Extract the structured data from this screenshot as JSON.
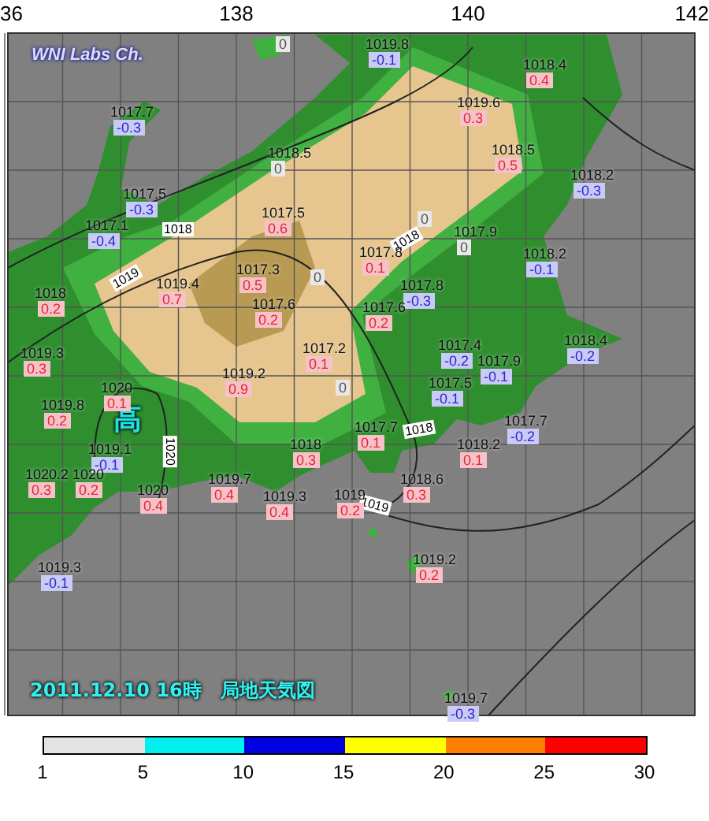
{
  "axis_labels": [
    {
      "text": "36"
    },
    {
      "text": "138"
    },
    {
      "text": "140"
    },
    {
      "text": "142"
    }
  ],
  "title": "WNI Labs Ch.",
  "high_marker": "高",
  "caption": "2011.12.10 16時　局地天気図",
  "isobar_labels": [
    "1018",
    "1019",
    "1020",
    "1018",
    "1019",
    "1018"
  ],
  "stations": [
    {
      "change": "0",
      "kind": "steady"
    },
    {
      "pressure": "1019.8",
      "change": "-0.1",
      "kind": "fall"
    },
    {
      "pressure": "1018.4",
      "change": "0.4",
      "kind": "rise"
    },
    {
      "pressure": "1017.7",
      "change": "-0.3",
      "kind": "fall"
    },
    {
      "pressure": "1019.6",
      "change": "0.3",
      "kind": "rise"
    },
    {
      "pressure": "1018.5",
      "change": "0",
      "kind": "steady"
    },
    {
      "pressure": "1018.5",
      "change": "0.5",
      "kind": "rise"
    },
    {
      "pressure": "1018.2",
      "change": "-0.3",
      "kind": "fall"
    },
    {
      "pressure": "1017.5",
      "change": "-0.3",
      "kind": "fall"
    },
    {
      "pressure": "1017.1",
      "change": "-0.4",
      "kind": "fall"
    },
    {
      "pressure": "1017.5",
      "change": "0.6",
      "kind": "rise"
    },
    {
      "change": "0",
      "kind": "steady"
    },
    {
      "pressure": "1017.9",
      "change": "0",
      "kind": "steady"
    },
    {
      "pressure": "1017.8",
      "change": "0.1",
      "kind": "rise"
    },
    {
      "pressure": "1018.2",
      "change": "-0.1",
      "kind": "fall"
    },
    {
      "pressure": "1018",
      "change": "0.2",
      "kind": "rise"
    },
    {
      "pressure": "1019.4",
      "change": "0.7",
      "kind": "rise"
    },
    {
      "pressure": "1017.3",
      "change": "0.5",
      "kind": "rise"
    },
    {
      "change": "0",
      "kind": "steady"
    },
    {
      "pressure": "1017.8",
      "change": "-0.3",
      "kind": "fall"
    },
    {
      "pressure": "1017.6",
      "change": "0.2",
      "kind": "rise"
    },
    {
      "pressure": "1017.6",
      "change": "0.2",
      "kind": "rise"
    },
    {
      "pressure": "1019.3",
      "change": "0.3",
      "kind": "rise"
    },
    {
      "pressure": "1017.2",
      "change": "0.1",
      "kind": "rise"
    },
    {
      "pressure": "1017.4",
      "change": "-0.2",
      "kind": "fall"
    },
    {
      "pressure": "1017.9",
      "change": "-0.1",
      "kind": "fall"
    },
    {
      "pressure": "1018.4",
      "change": "-0.2",
      "kind": "fall"
    },
    {
      "pressure": "1020",
      "change": "0.1",
      "kind": "rise"
    },
    {
      "pressure": "1019.2",
      "change": "0.9",
      "kind": "rise"
    },
    {
      "change": "0",
      "kind": "steady"
    },
    {
      "pressure": "1017.5",
      "change": "-0.1",
      "kind": "fall"
    },
    {
      "pressure": "1019.8",
      "change": "0.2",
      "kind": "rise"
    },
    {
      "pressure": "1017.7",
      "change": "0.1",
      "kind": "rise"
    },
    {
      "pressure": "1017.7",
      "change": "-0.2",
      "kind": "fall"
    },
    {
      "pressure": "1019.1",
      "change": "-0.1",
      "kind": "fall"
    },
    {
      "pressure": "1018",
      "change": "0.3",
      "kind": "rise"
    },
    {
      "pressure": "1018.2",
      "change": "0.1",
      "kind": "rise"
    },
    {
      "pressure": "1020.2",
      "change": "0.3",
      "kind": "rise"
    },
    {
      "pressure": "1020",
      "change": "0.2",
      "kind": "rise"
    },
    {
      "pressure": "1019.7",
      "change": "0.4",
      "kind": "rise"
    },
    {
      "pressure": "1018.6",
      "change": "0.3",
      "kind": "rise"
    },
    {
      "pressure": "1020",
      "change": "0.4",
      "kind": "rise"
    },
    {
      "pressure": "1019.3",
      "change": "0.4",
      "kind": "rise"
    },
    {
      "pressure": "1019",
      "change": "0.2",
      "kind": "rise"
    },
    {
      "pressure": "1019.2",
      "change": "0.2",
      "kind": "rise"
    },
    {
      "pressure": "1019.3",
      "change": "-0.1",
      "kind": "fall"
    },
    {
      "pressure": "1019.7",
      "change": "-0.3",
      "kind": "fall"
    }
  ],
  "legend": {
    "segments": [
      {
        "color": "#e4e4e4"
      },
      {
        "color": "#00f0f0"
      },
      {
        "color": "#0000e0"
      },
      {
        "color": "#ffff00"
      },
      {
        "color": "#ff8000"
      },
      {
        "color": "#ff0000"
      }
    ],
    "ticks": [
      "1",
      "5",
      "10",
      "15",
      "20",
      "25",
      "30"
    ]
  }
}
